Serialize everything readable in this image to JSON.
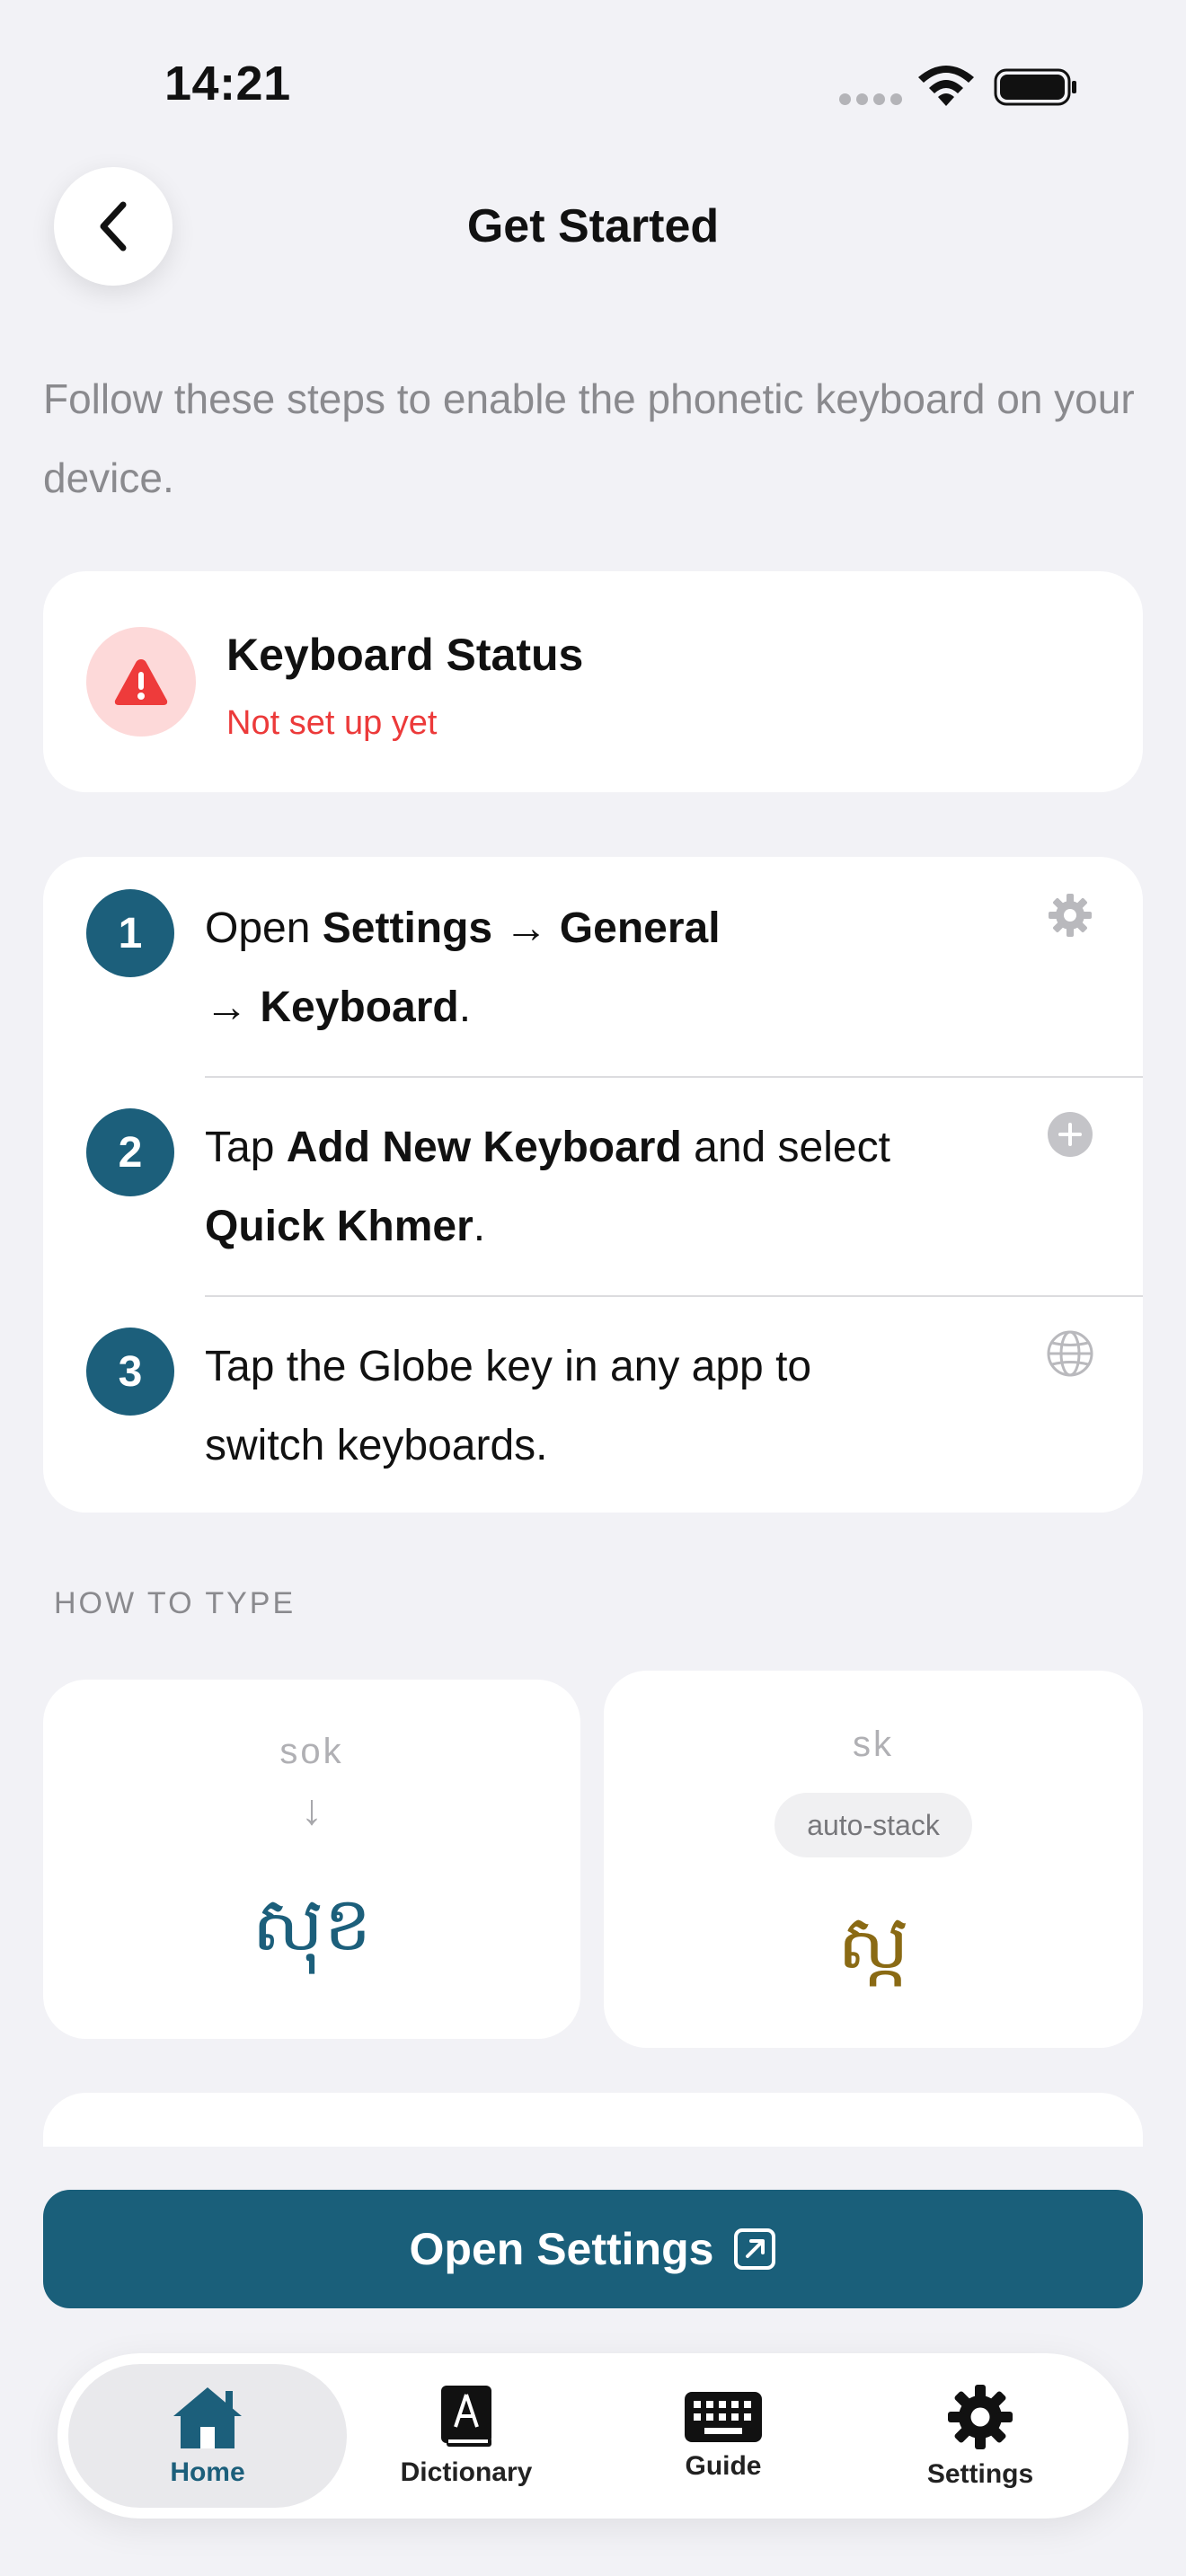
{
  "status_bar": {
    "time": "14:21"
  },
  "nav": {
    "title": "Get Started",
    "back_icon": "chevron-left-icon"
  },
  "intro": "Follow these steps to enable the phonetic keyboard on your device.",
  "keyboard_status": {
    "title": "Keyboard Status",
    "status": "Not set up yet",
    "icon": "warning-icon",
    "status_color": "#ec3a3a"
  },
  "steps": [
    {
      "number": "1",
      "parts": [
        "Open ",
        "Settings",
        " → ",
        "General",
        " → ",
        "Keyboard",
        "."
      ],
      "icon": "gear-icon"
    },
    {
      "number": "2",
      "parts": [
        "Tap ",
        "Add New Keyboard",
        " and select ",
        "Quick Khmer",
        "."
      ],
      "icon": "plus-circle-icon"
    },
    {
      "number": "3",
      "parts": [
        "Tap the Globe key in any app to switch keyboards."
      ],
      "icon": "globe-icon"
    }
  ],
  "how_to_type": {
    "label": "HOW TO TYPE",
    "examples": [
      {
        "input": "sok",
        "output": "សុខ",
        "arrow": "↓"
      },
      {
        "input": "sk",
        "chip": "auto-stack",
        "output": "ស្ក"
      }
    ]
  },
  "primary_button": {
    "label": "Open Settings",
    "icon": "external-link-icon"
  },
  "tab_bar": {
    "items": [
      {
        "label": "Home",
        "icon": "home-icon",
        "active": true
      },
      {
        "label": "Dictionary",
        "icon": "dictionary-icon",
        "active": false
      },
      {
        "label": "Guide",
        "icon": "keyboard-icon",
        "active": false
      },
      {
        "label": "Settings",
        "icon": "gear-icon",
        "active": false
      }
    ]
  },
  "colors": {
    "accent": "#1c5f7b",
    "background": "#f2f2f6",
    "warning": "#ec3a3a"
  }
}
